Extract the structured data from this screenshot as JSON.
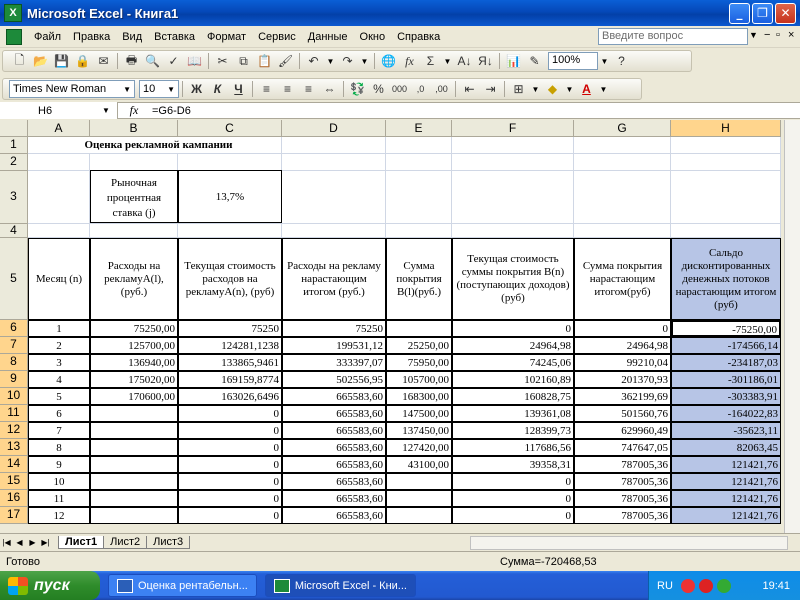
{
  "window": {
    "title": "Microsoft Excel - Книга1",
    "minimize": "_",
    "restore": "❐",
    "close": "✕"
  },
  "menu": {
    "items": [
      "Файл",
      "Правка",
      "Вид",
      "Вставка",
      "Формат",
      "Сервис",
      "Данные",
      "Окно",
      "Справка"
    ],
    "help_placeholder": "Введите вопрос",
    "doc_min": "−",
    "doc_restore": "▫",
    "doc_close": "×"
  },
  "toolbar": {
    "zoom": "100%",
    "font": "Times New Roman",
    "size": "10",
    "bold": "Ж",
    "italic": "К",
    "underline": "Ч",
    "percent": "%",
    "thousands": "000",
    "inc_dec": ",0",
    "dec_dec": ",00"
  },
  "formula_bar": {
    "cell_ref": "H6",
    "fx": "fx",
    "formula": "=G6-D6"
  },
  "columns": [
    "A",
    "B",
    "C",
    "D",
    "E",
    "F",
    "G",
    "H"
  ],
  "rows": [
    "1",
    "2",
    "3",
    "4",
    "5",
    "6",
    "7",
    "8",
    "9",
    "10",
    "11",
    "12",
    "13",
    "14",
    "15",
    "16",
    "17"
  ],
  "sheet": {
    "title": "Оценка рекламной кампании",
    "rate_label": "Рыночная процентная ставка (j)",
    "rate_value": "13,7%",
    "headers": {
      "A": "Месяц (n)",
      "B": "Расходы на рекламуA(l), (руб.)",
      "C": "Текущая стоимость расходов на рекламуA(n), (руб)",
      "D": "Расходы на рекламу нарастающим итогом (руб.)",
      "E": "Сумма покрытия B(l)(руб.)",
      "F": "Текущая стоимость суммы покрытия B(n)(поступающих доходов) (руб)",
      "G": "Сумма покрытия нарастающим итогом(руб)",
      "H": "Сальдо дисконтированных денежных потоков нарастающим итогом (руб)"
    },
    "data": [
      [
        "1",
        "75250,00",
        "75250",
        "75250",
        "",
        "0",
        "0",
        "-75250,00"
      ],
      [
        "2",
        "125700,00",
        "124281,1238",
        "199531,12",
        "25250,00",
        "24964,98",
        "24964,98",
        "-174566,14"
      ],
      [
        "3",
        "136940,00",
        "133865,9461",
        "333397,07",
        "75950,00",
        "74245,06",
        "99210,04",
        "-234187,03"
      ],
      [
        "4",
        "175020,00",
        "169159,8774",
        "502556,95",
        "105700,00",
        "102160,89",
        "201370,93",
        "-301186,01"
      ],
      [
        "5",
        "170600,00",
        "163026,6496",
        "665583,60",
        "168300,00",
        "160828,75",
        "362199,69",
        "-303383,91"
      ],
      [
        "6",
        "",
        "0",
        "665583,60",
        "147500,00",
        "139361,08",
        "501560,76",
        "-164022,83"
      ],
      [
        "7",
        "",
        "0",
        "665583,60",
        "137450,00",
        "128399,73",
        "629960,49",
        "-35623,11"
      ],
      [
        "8",
        "",
        "0",
        "665583,60",
        "127420,00",
        "117686,56",
        "747647,05",
        "82063,45"
      ],
      [
        "9",
        "",
        "0",
        "665583,60",
        "43100,00",
        "39358,31",
        "787005,36",
        "121421,76"
      ],
      [
        "10",
        "",
        "0",
        "665583,60",
        "",
        "0",
        "787005,36",
        "121421,76"
      ],
      [
        "11",
        "",
        "0",
        "665583,60",
        "",
        "0",
        "787005,36",
        "121421,76"
      ],
      [
        "12",
        "",
        "0",
        "665583,60",
        "",
        "0",
        "787005,36",
        "121421,76"
      ]
    ]
  },
  "tabs": [
    "Лист1",
    "Лист2",
    "Лист3"
  ],
  "status": {
    "ready": "Готово",
    "sum": "Сумма=-720468,53"
  },
  "taskbar": {
    "start": "пуск",
    "tasks": [
      "Оценка рентабельн...",
      "Microsoft Excel - Кни..."
    ],
    "lang": "RU",
    "clock": "19:41"
  },
  "colors": {
    "selection": "#b7c5e6",
    "header_selected": "#ffd58d",
    "titlebar": "#0548b8"
  }
}
